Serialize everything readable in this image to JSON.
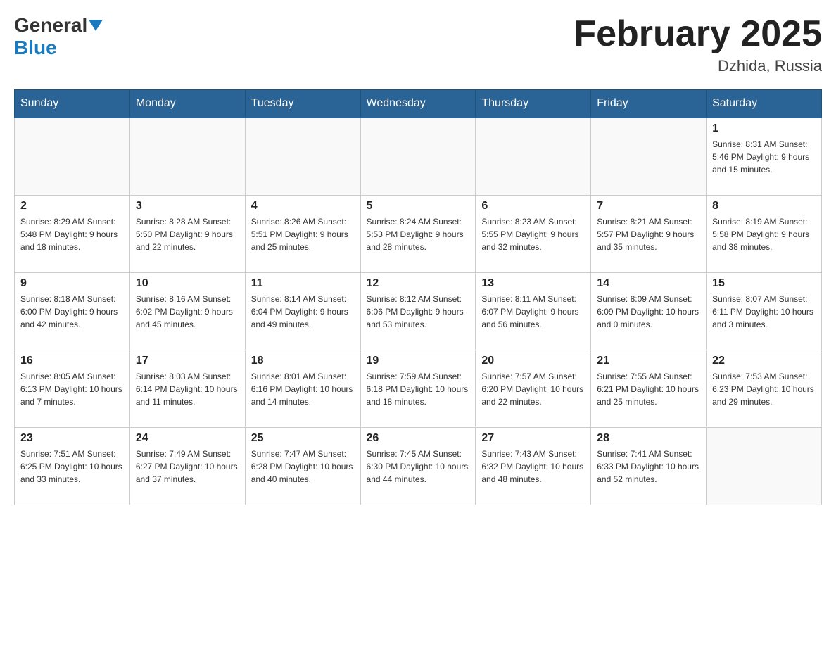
{
  "header": {
    "logo_general": "General",
    "logo_blue": "Blue",
    "title": "February 2025",
    "subtitle": "Dzhida, Russia"
  },
  "days_of_week": [
    "Sunday",
    "Monday",
    "Tuesday",
    "Wednesday",
    "Thursday",
    "Friday",
    "Saturday"
  ],
  "weeks": [
    [
      {
        "day": "",
        "info": ""
      },
      {
        "day": "",
        "info": ""
      },
      {
        "day": "",
        "info": ""
      },
      {
        "day": "",
        "info": ""
      },
      {
        "day": "",
        "info": ""
      },
      {
        "day": "",
        "info": ""
      },
      {
        "day": "1",
        "info": "Sunrise: 8:31 AM\nSunset: 5:46 PM\nDaylight: 9 hours and 15 minutes."
      }
    ],
    [
      {
        "day": "2",
        "info": "Sunrise: 8:29 AM\nSunset: 5:48 PM\nDaylight: 9 hours and 18 minutes."
      },
      {
        "day": "3",
        "info": "Sunrise: 8:28 AM\nSunset: 5:50 PM\nDaylight: 9 hours and 22 minutes."
      },
      {
        "day": "4",
        "info": "Sunrise: 8:26 AM\nSunset: 5:51 PM\nDaylight: 9 hours and 25 minutes."
      },
      {
        "day": "5",
        "info": "Sunrise: 8:24 AM\nSunset: 5:53 PM\nDaylight: 9 hours and 28 minutes."
      },
      {
        "day": "6",
        "info": "Sunrise: 8:23 AM\nSunset: 5:55 PM\nDaylight: 9 hours and 32 minutes."
      },
      {
        "day": "7",
        "info": "Sunrise: 8:21 AM\nSunset: 5:57 PM\nDaylight: 9 hours and 35 minutes."
      },
      {
        "day": "8",
        "info": "Sunrise: 8:19 AM\nSunset: 5:58 PM\nDaylight: 9 hours and 38 minutes."
      }
    ],
    [
      {
        "day": "9",
        "info": "Sunrise: 8:18 AM\nSunset: 6:00 PM\nDaylight: 9 hours and 42 minutes."
      },
      {
        "day": "10",
        "info": "Sunrise: 8:16 AM\nSunset: 6:02 PM\nDaylight: 9 hours and 45 minutes."
      },
      {
        "day": "11",
        "info": "Sunrise: 8:14 AM\nSunset: 6:04 PM\nDaylight: 9 hours and 49 minutes."
      },
      {
        "day": "12",
        "info": "Sunrise: 8:12 AM\nSunset: 6:06 PM\nDaylight: 9 hours and 53 minutes."
      },
      {
        "day": "13",
        "info": "Sunrise: 8:11 AM\nSunset: 6:07 PM\nDaylight: 9 hours and 56 minutes."
      },
      {
        "day": "14",
        "info": "Sunrise: 8:09 AM\nSunset: 6:09 PM\nDaylight: 10 hours and 0 minutes."
      },
      {
        "day": "15",
        "info": "Sunrise: 8:07 AM\nSunset: 6:11 PM\nDaylight: 10 hours and 3 minutes."
      }
    ],
    [
      {
        "day": "16",
        "info": "Sunrise: 8:05 AM\nSunset: 6:13 PM\nDaylight: 10 hours and 7 minutes."
      },
      {
        "day": "17",
        "info": "Sunrise: 8:03 AM\nSunset: 6:14 PM\nDaylight: 10 hours and 11 minutes."
      },
      {
        "day": "18",
        "info": "Sunrise: 8:01 AM\nSunset: 6:16 PM\nDaylight: 10 hours and 14 minutes."
      },
      {
        "day": "19",
        "info": "Sunrise: 7:59 AM\nSunset: 6:18 PM\nDaylight: 10 hours and 18 minutes."
      },
      {
        "day": "20",
        "info": "Sunrise: 7:57 AM\nSunset: 6:20 PM\nDaylight: 10 hours and 22 minutes."
      },
      {
        "day": "21",
        "info": "Sunrise: 7:55 AM\nSunset: 6:21 PM\nDaylight: 10 hours and 25 minutes."
      },
      {
        "day": "22",
        "info": "Sunrise: 7:53 AM\nSunset: 6:23 PM\nDaylight: 10 hours and 29 minutes."
      }
    ],
    [
      {
        "day": "23",
        "info": "Sunrise: 7:51 AM\nSunset: 6:25 PM\nDaylight: 10 hours and 33 minutes."
      },
      {
        "day": "24",
        "info": "Sunrise: 7:49 AM\nSunset: 6:27 PM\nDaylight: 10 hours and 37 minutes."
      },
      {
        "day": "25",
        "info": "Sunrise: 7:47 AM\nSunset: 6:28 PM\nDaylight: 10 hours and 40 minutes."
      },
      {
        "day": "26",
        "info": "Sunrise: 7:45 AM\nSunset: 6:30 PM\nDaylight: 10 hours and 44 minutes."
      },
      {
        "day": "27",
        "info": "Sunrise: 7:43 AM\nSunset: 6:32 PM\nDaylight: 10 hours and 48 minutes."
      },
      {
        "day": "28",
        "info": "Sunrise: 7:41 AM\nSunset: 6:33 PM\nDaylight: 10 hours and 52 minutes."
      },
      {
        "day": "",
        "info": ""
      }
    ]
  ]
}
